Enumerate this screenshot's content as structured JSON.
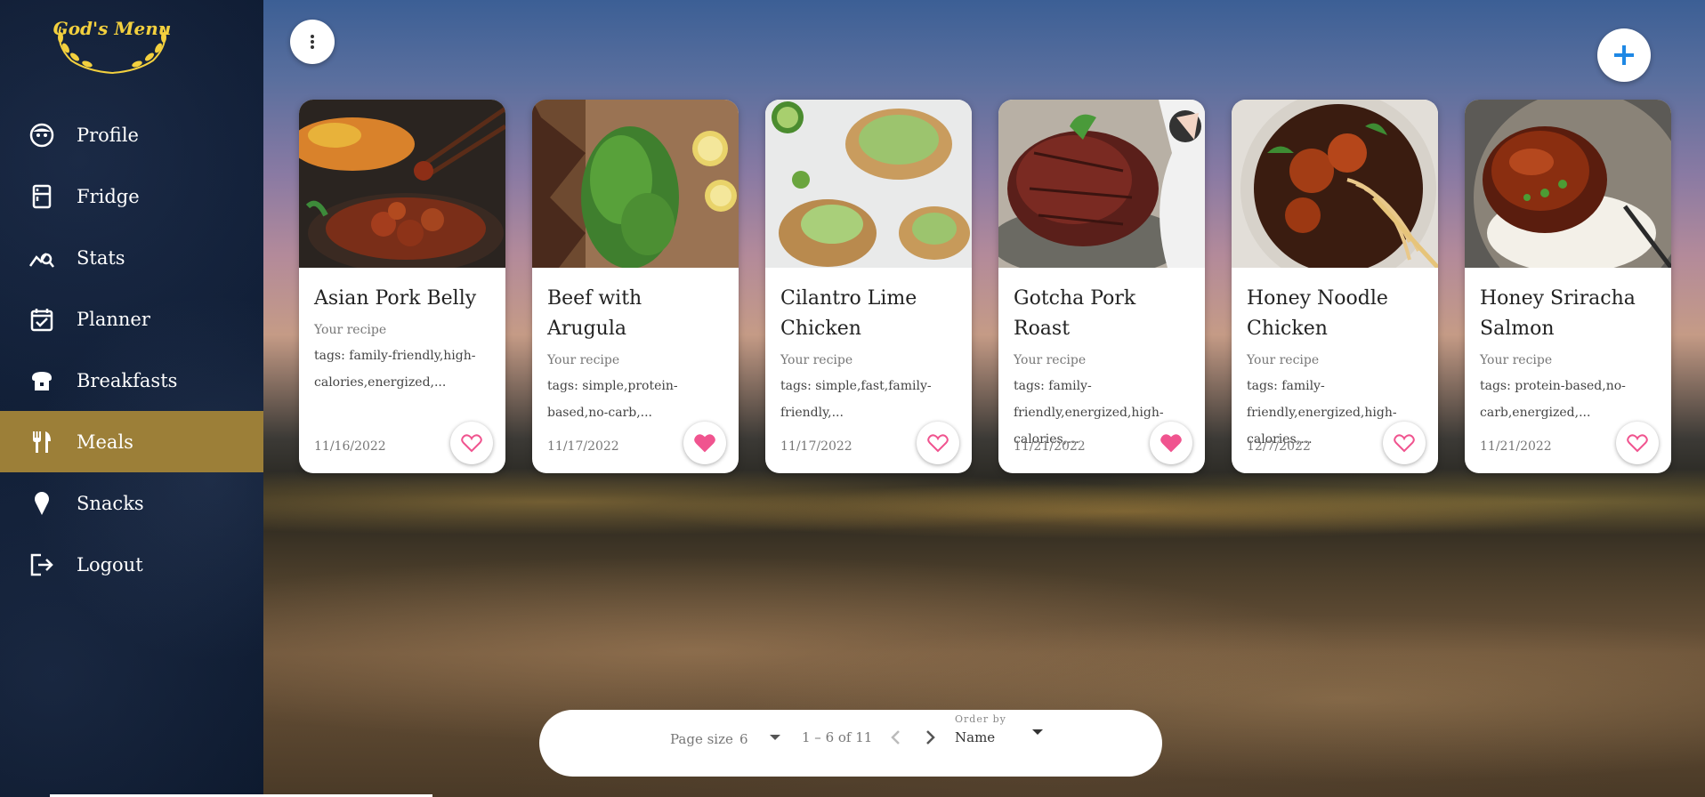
{
  "app": {
    "logo_text": "God's Menu"
  },
  "sidebar": {
    "items": [
      {
        "label": "Profile",
        "icon": "face-icon"
      },
      {
        "label": "Fridge",
        "icon": "fridge-icon"
      },
      {
        "label": "Stats",
        "icon": "stats-icon"
      },
      {
        "label": "Planner",
        "icon": "calendar-check-icon"
      },
      {
        "label": "Breakfasts",
        "icon": "bread-icon"
      },
      {
        "label": "Meals",
        "icon": "utensils-icon",
        "active": true
      },
      {
        "label": "Snacks",
        "icon": "ice-cream-icon"
      },
      {
        "label": "Logout",
        "icon": "logout-icon"
      }
    ]
  },
  "toolbar": {
    "menu_icon": "more-vert-icon",
    "add_icon": "plus-icon"
  },
  "recipes": [
    {
      "title": "Asian Pork Belly",
      "subtitle": "Your recipe",
      "tags": "tags: family-friendly,high-calories,energized,...",
      "date": "11/16/2022",
      "favorite": false
    },
    {
      "title": "Beef with Arugula",
      "subtitle": "Your recipe",
      "tags": "tags: simple,protein-based,no-carb,...",
      "date": "11/17/2022",
      "favorite": true
    },
    {
      "title": "Cilantro Lime Chicken",
      "subtitle": "Your recipe",
      "tags": "tags: simple,fast,family-friendly,...",
      "date": "11/17/2022",
      "favorite": false
    },
    {
      "title": "Gotcha Pork Roast",
      "subtitle": "Your recipe",
      "tags": "tags: family-friendly,energized,high-calories,...",
      "date": "11/21/2022",
      "favorite": true
    },
    {
      "title": "Honey Noodle Chicken",
      "subtitle": "Your recipe",
      "tags": "tags: family-friendly,energized,high-calories,...",
      "date": "12/7/2022",
      "favorite": false
    },
    {
      "title": "Honey Sriracha Salmon",
      "subtitle": "Your recipe",
      "tags": "tags: protein-based,no-carb,energized,...",
      "date": "11/21/2022",
      "favorite": false
    }
  ],
  "paginator": {
    "page_size_label": "Page size",
    "page_size": "6",
    "range": "1 – 6 of 11",
    "order_label": "Order by",
    "order_value": "Name"
  },
  "colors": {
    "accent": "#9c7f38",
    "heart": "#f0548f",
    "add": "#1e88e5",
    "logo": "#f3d03e"
  }
}
